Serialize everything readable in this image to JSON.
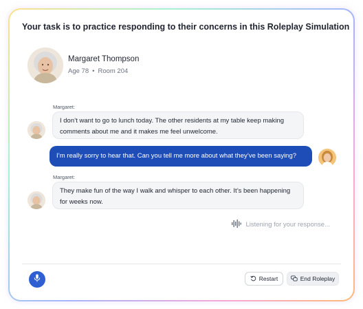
{
  "title": "Your task is to practice responding to their concerns in this Roleplay Simulation",
  "profile": {
    "name": "Margaret Thompson",
    "age": "Age 78",
    "separator": "•",
    "room": "Room 204"
  },
  "messages": [
    {
      "speaker": "Margaret:",
      "lines": [
        "I don’t want to go to lunch today. The other residents at my table keep making",
        "comments about me and it makes me feel unwelcome."
      ]
    },
    {
      "speaker": "",
      "lines": [
        "I’m really sorry to hear that. Can you tell me more about what they’ve been saying?"
      ]
    },
    {
      "speaker": "Margaret:",
      "lines": [
        "They make fun of the way I walk and whisper to each other. It’s been happening",
        "for weeks now."
      ]
    }
  ],
  "status": {
    "listening_text": "Listening for your response..."
  },
  "footer": {
    "restart_label": "Restart",
    "end_label": "End Roleplay"
  },
  "icons": {
    "waveform": "waveform-icon",
    "mic": "microphone-icon",
    "restart": "restart-icon",
    "end": "end-roleplay-icon"
  },
  "colors": {
    "user_bubble": "#1f4db8",
    "mic_button": "#2f5fd0",
    "resident_bubble": "#f4f5f7"
  }
}
